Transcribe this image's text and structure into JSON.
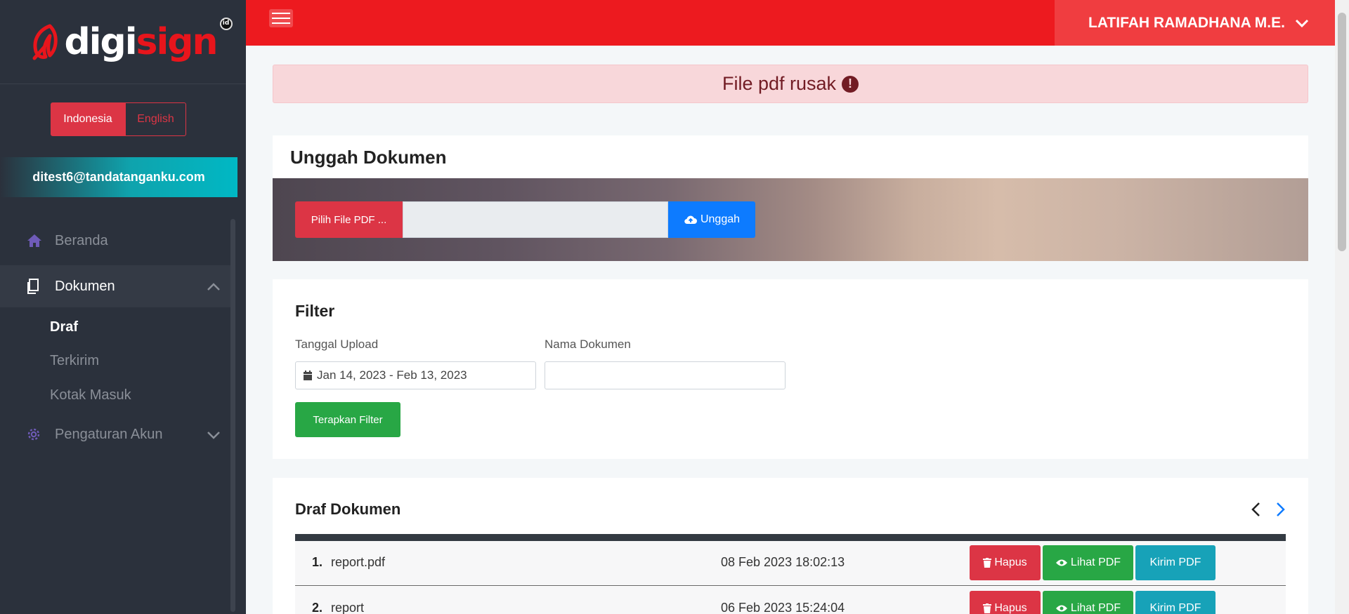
{
  "brand": {
    "part1": "digi",
    "part2": "sign",
    "badge": "id"
  },
  "language": {
    "active": "Indonesia",
    "other": "English"
  },
  "account": {
    "email": "ditest6@tandatanganku.com"
  },
  "sidebar": {
    "items": [
      {
        "label": "Beranda",
        "icon": "home-icon"
      },
      {
        "label": "Dokumen",
        "icon": "document-icon",
        "expanded": true,
        "children": [
          "Draf",
          "Terkirim",
          "Kotak Masuk"
        ],
        "active_child": "Draf"
      },
      {
        "label": "Pengaturan Akun",
        "icon": "gear-icon",
        "expanded": false
      }
    ]
  },
  "topbar": {
    "user_name": "LATIFAH RAMADHANA M.E."
  },
  "alert": {
    "message": "File pdf rusak",
    "color": "#721c24"
  },
  "upload": {
    "title": "Unggah Dokumen",
    "pick_label": "Pilih File PDF ...",
    "upload_label": "Unggah"
  },
  "filter": {
    "title": "Filter",
    "date_label": "Tanggal Upload",
    "date_value": "Jan 14, 2023 - Feb 13, 2023",
    "name_label": "Nama Dokumen",
    "name_value": "",
    "apply_label": "Terapkan Filter"
  },
  "drafts": {
    "title": "Draf Dokumen",
    "delete_label": "Hapus",
    "view_label": "Lihat PDF",
    "send_label": "Kirim PDF",
    "rows": [
      {
        "no": "1.",
        "name": "report.pdf",
        "date": "08 Feb 2023 18:02:13"
      },
      {
        "no": "2.",
        "name": "report",
        "date": "06 Feb 2023 15:24:04"
      }
    ]
  },
  "colors": {
    "topbar": "#ed1a1f",
    "danger": "#dc3545",
    "success": "#28a745",
    "info": "#17a2b8",
    "primary": "#0d7bff",
    "sidebar": "#2b313c"
  }
}
